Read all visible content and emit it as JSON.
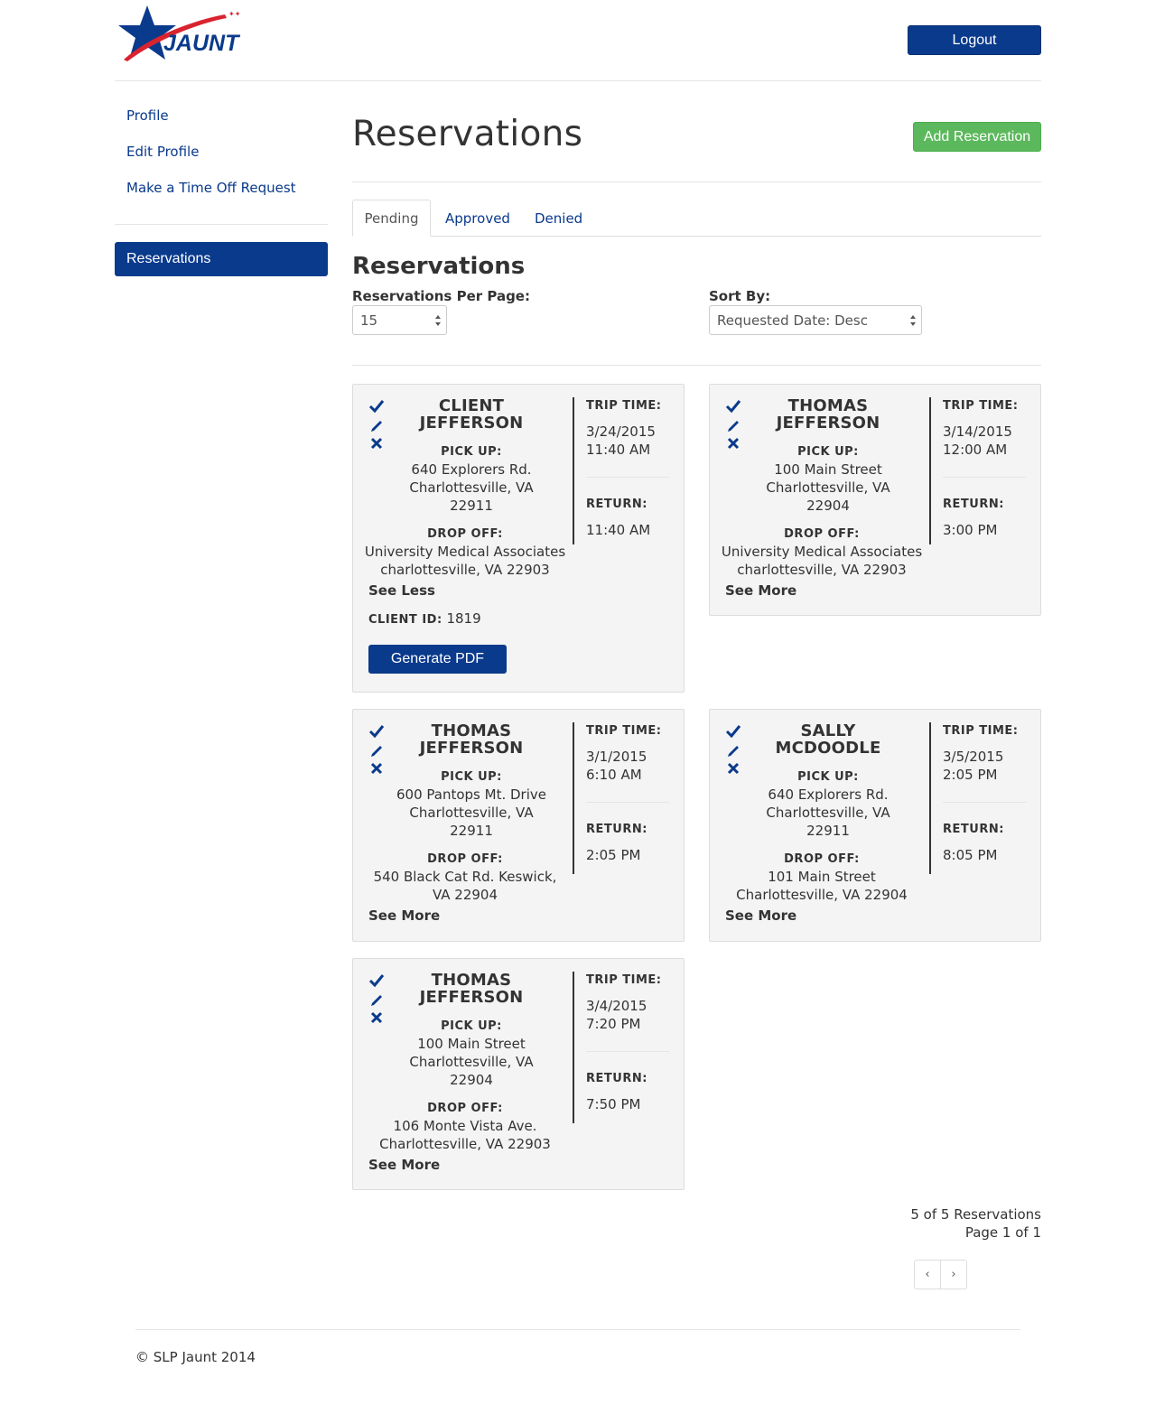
{
  "brand": {
    "logo_text": "JAUNT",
    "primary": "#0a3a8c",
    "accent_red": "#d9232e",
    "success": "#5cb85c"
  },
  "header": {
    "logout_label": "Logout"
  },
  "sidebar": {
    "links": [
      "Profile",
      "Edit Profile",
      "Make a Time Off Request"
    ],
    "active": "Reservations"
  },
  "main": {
    "title": "Reservations",
    "add_label": "Add Reservation",
    "tabs": [
      "Pending",
      "Approved",
      "Denied"
    ],
    "section_title": "Reservations",
    "per_page_label": "Reservations Per Page:",
    "per_page_value": "15",
    "sort_label": "Sort By:",
    "sort_value": "Requested Date: Desc"
  },
  "labels": {
    "pick_up": "PICK UP:",
    "drop_off": "DROP OFF:",
    "trip_time": "TRIP TIME:",
    "return": "RETURN:",
    "see_more": "See More",
    "see_less": "See Less",
    "client_id": "CLIENT ID:",
    "generate_pdf": "Generate PDF"
  },
  "reservations": [
    {
      "name": [
        "CLIENT",
        "JEFFERSON"
      ],
      "pickup": [
        "640 Explorers Rd.",
        "Charlottesville, VA",
        "22911"
      ],
      "dropoff": [
        "University Medical Associates",
        "charlottesville, VA 22903"
      ],
      "trip_date": "3/24/2015",
      "trip_time": "11:40 AM",
      "return_time": "11:40 AM",
      "expanded": true,
      "client_id": "1819"
    },
    {
      "name": [
        "THOMAS",
        "JEFFERSON"
      ],
      "pickup": [
        "100 Main Street",
        "Charlottesville, VA",
        "22904"
      ],
      "dropoff": [
        "University Medical Associates",
        "charlottesville, VA 22903"
      ],
      "trip_date": "3/14/2015",
      "trip_time": "12:00 AM",
      "return_time": "3:00 PM",
      "expanded": false
    },
    {
      "name": [
        "THOMAS",
        "JEFFERSON"
      ],
      "pickup": [
        "600 Pantops Mt. Drive",
        "Charlottesville, VA",
        "22911"
      ],
      "dropoff": [
        "540 Black Cat Rd. Keswick,",
        "VA 22904"
      ],
      "trip_date": "3/1/2015",
      "trip_time": "6:10 AM",
      "return_time": "2:05 PM",
      "expanded": false
    },
    {
      "name": [
        "SALLY",
        "MCDOODLE"
      ],
      "pickup": [
        "640 Explorers Rd.",
        "Charlottesville, VA",
        "22911"
      ],
      "dropoff": [
        "101 Main Street",
        "Charlottesville, VA 22904"
      ],
      "trip_date": "3/5/2015",
      "trip_time": "2:05 PM",
      "return_time": "8:05 PM",
      "expanded": false
    },
    {
      "name": [
        "THOMAS",
        "JEFFERSON"
      ],
      "pickup": [
        "100 Main Street",
        "Charlottesville, VA",
        "22904"
      ],
      "dropoff": [
        "106 Monte Vista Ave.",
        "Charlottesville, VA 22903"
      ],
      "trip_date": "3/4/2015",
      "trip_time": "7:20 PM",
      "return_time": "7:50 PM",
      "expanded": false
    }
  ],
  "summary": {
    "count": "5 of 5 Reservations",
    "page": "Page 1 of 1",
    "prev": "‹",
    "next": "›"
  },
  "footer": {
    "copyright": "© SLP Jaunt 2014"
  }
}
